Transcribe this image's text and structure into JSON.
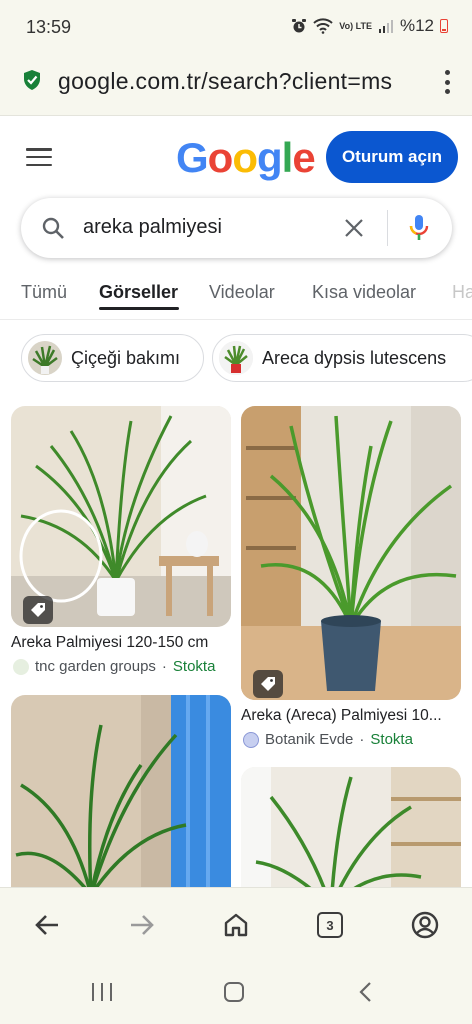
{
  "status_bar": {
    "time": "13:59",
    "network": "Vo) LTE",
    "battery": "%12"
  },
  "url_bar": {
    "url": "google.com.tr/search?client=ms"
  },
  "header": {
    "logo": "Google",
    "signin_label": "Oturum açın"
  },
  "search": {
    "query": "areka palmiyesi"
  },
  "tabs": [
    {
      "label": "Tümü"
    },
    {
      "label": "Görseller"
    },
    {
      "label": "Videolar"
    },
    {
      "label": "Kısa videolar"
    },
    {
      "label": "Ha"
    }
  ],
  "chips": [
    {
      "label": "Çiçeği bakımı"
    },
    {
      "label": "Areca dypsis lutescens"
    }
  ],
  "results": [
    {
      "title": "Areka Palmiyesi 120-150 cm",
      "source": "tnc garden groups",
      "stock": "Stokta"
    },
    {
      "title": "Areka (Areca) Palmiyesi 10...",
      "source": "Botanik Evde",
      "stock": "Stokta"
    }
  ],
  "separator": "·",
  "toolbar": {
    "tab_count": "3"
  },
  "colors": {
    "accent": "#0b57d0",
    "stock": "#188038",
    "chrome_bg": "#f7f7ee"
  }
}
